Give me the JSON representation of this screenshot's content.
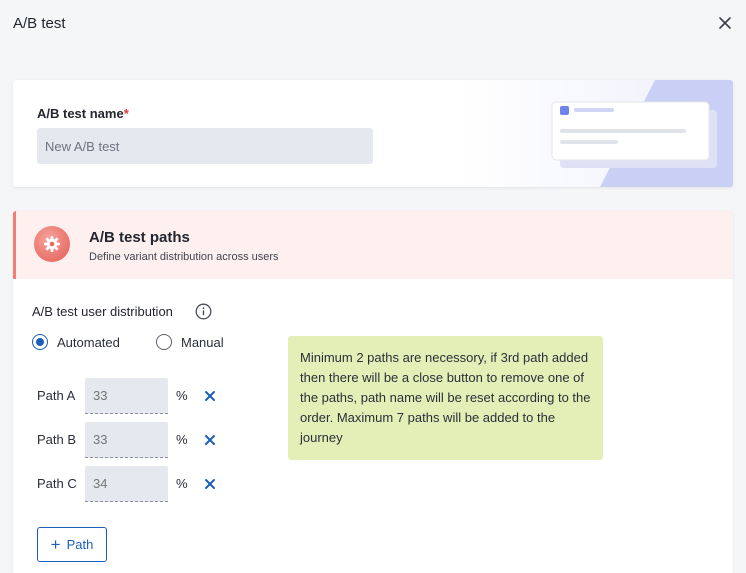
{
  "header": {
    "title": "A/B test",
    "close_icon": "close-icon"
  },
  "name_card": {
    "label": "A/B test name",
    "required_mark": "*",
    "input_placeholder": "New A/B test",
    "input_value": ""
  },
  "paths_card": {
    "title": "A/B test paths",
    "subtitle": "Define variant distribution across users",
    "icon": "gear-icon",
    "distribution_label": "A/B test user distribution",
    "distribution_mode": "Automated",
    "options": [
      {
        "label": "Automated",
        "selected": true
      },
      {
        "label": "Manual",
        "selected": false
      }
    ],
    "paths": [
      {
        "label": "Path A",
        "value": "33",
        "unit": "%"
      },
      {
        "label": "Path B",
        "value": "33",
        "unit": "%"
      },
      {
        "label": "Path C",
        "value": "34",
        "unit": "%"
      }
    ],
    "add_button_label": "Path",
    "note": "Minimum 2 paths are necessory, if 3rd path added then there will be a close button to remove one of the paths, path name will be reset according to the order. Maximum 7 paths will be added to the journey"
  },
  "colors": {
    "accent": "#1c5fb8",
    "section_band": "#fdf0ef",
    "section_icon": "#e35b54",
    "note_bg": "#e3efb7",
    "required": "#d93a3a"
  }
}
